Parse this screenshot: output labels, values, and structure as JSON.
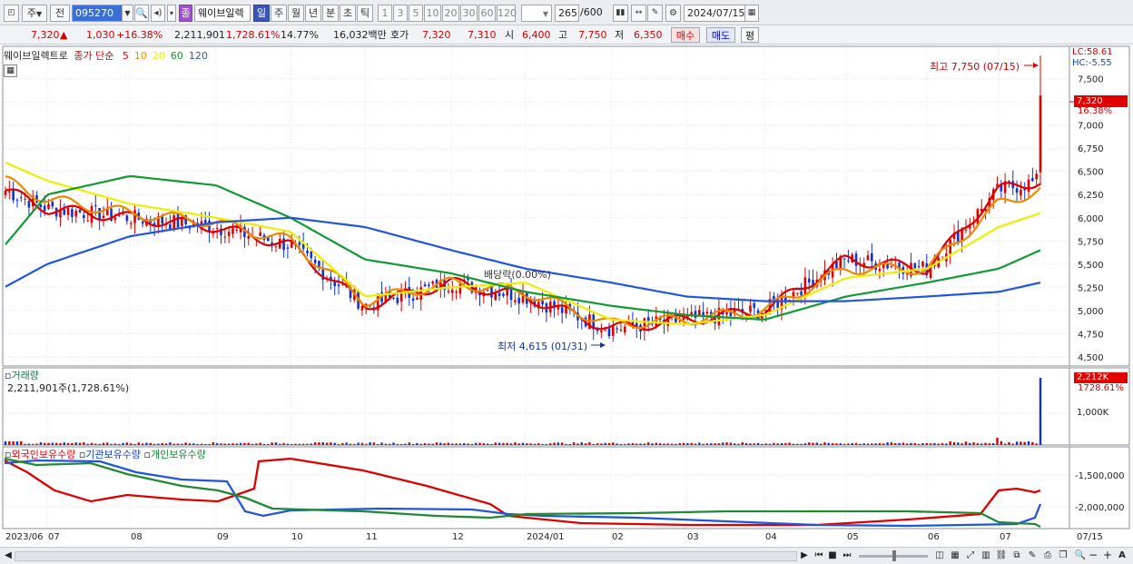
{
  "toolbar": {
    "type_select": "주",
    "prev_label": "전",
    "code_value": "095270",
    "stock_badge": "종",
    "stock_name": "웨이브일렉",
    "periods": [
      "일",
      "주",
      "월",
      "년",
      "분",
      "초",
      "틱"
    ],
    "active_period": "일",
    "intervals": [
      "1",
      "3",
      "5",
      "10",
      "20",
      "30",
      "60",
      "120"
    ],
    "count_value": "265",
    "count_total": "/600",
    "date_value": "2024/07/15"
  },
  "quote": {
    "price": "7,320",
    "arrow": "▲",
    "change": "1,030",
    "change_pct": "+16.38%",
    "volume": "2,211,901",
    "volume_pct": "1,728.61%",
    "turnover": "14.77%",
    "amount": "16,032백만",
    "bid_label": "호가",
    "ask_price": "7,320",
    "bid_price": "7,310",
    "open_label": "시",
    "open": "6,400",
    "high_label": "고",
    "high": "7,750",
    "low_label": "저",
    "low": "6,350",
    "buy_label": "매수",
    "sell_label": "매도",
    "eval_label": "평"
  },
  "price_panel": {
    "name": "웨이브일렉트로",
    "ma_prefix": "종가 단순",
    "ma_periods": [
      "5",
      "10",
      "20",
      "60",
      "120"
    ],
    "ma_colors": [
      "#dd0000",
      "#ee8800",
      "#eeee00",
      "#119933",
      "#2255dd"
    ],
    "lc": "LC:58.61",
    "hc": "HC:-5.55",
    "current_price": "7,320",
    "current_pct": "16.38%",
    "high_label": "최고 7,750 (07/15)",
    "low_label": "최저 4,615 (01/31)",
    "dividend_label": "배당락(0.00%)",
    "y_ticks": [
      "7,500",
      "7,250",
      "7,000",
      "6,750",
      "6,500",
      "6,250",
      "6,000",
      "5,750",
      "5,500",
      "5,250",
      "5,000",
      "4,750",
      "4,500"
    ]
  },
  "volume_panel": {
    "title": "거래량",
    "value": "2,211,901주(1,728.61%)",
    "current": "2,212K",
    "current_pct": "1728.61%",
    "tick": "1,000K"
  },
  "holdings_panel": {
    "foreign": "외국인보유수량",
    "inst": "기관보유수량",
    "indiv": "개인보유수량",
    "y_ticks": [
      "-1,500,000",
      "-2,000,000"
    ]
  },
  "x_axis": {
    "labels": [
      "2023/06",
      "07",
      "08",
      "09",
      "10",
      "11",
      "12",
      "2024/01",
      "02",
      "03",
      "04",
      "05",
      "06",
      "07"
    ],
    "right_label": "07/15"
  },
  "chart_data": {
    "type": "line",
    "x": [
      "2023/06",
      "07",
      "08",
      "09",
      "10",
      "11",
      "12",
      "2024/01",
      "02",
      "03",
      "04",
      "05",
      "06",
      "07",
      "07/15"
    ],
    "series": [
      {
        "name": "5",
        "values": [
          6300,
          6100,
          6000,
          5900,
          5700,
          5050,
          5300,
          5150,
          4800,
          4900,
          5000,
          5550,
          5450,
          6300,
          6400
        ]
      },
      {
        "name": "10",
        "values": [
          6400,
          6200,
          6050,
          5950,
          5750,
          5100,
          5300,
          5200,
          4850,
          4900,
          5000,
          5450,
          5450,
          6150,
          6300
        ]
      },
      {
        "name": "20",
        "values": [
          6600,
          6400,
          6150,
          6000,
          5850,
          5150,
          5250,
          5300,
          4900,
          4850,
          4950,
          5350,
          5450,
          5900,
          6050
        ]
      },
      {
        "name": "60",
        "values": [
          5700,
          6250,
          6450,
          6350,
          6000,
          5550,
          5400,
          5200,
          5050,
          4950,
          4900,
          5150,
          5300,
          5450,
          5650
        ]
      },
      {
        "name": "120",
        "values": [
          5250,
          5500,
          5800,
          5950,
          6000,
          5900,
          5650,
          5450,
          5300,
          5150,
          5100,
          5100,
          5150,
          5200,
          5300
        ]
      }
    ],
    "ylim": [
      4500,
      7750
    ],
    "high": 7750,
    "low": 4615
  }
}
